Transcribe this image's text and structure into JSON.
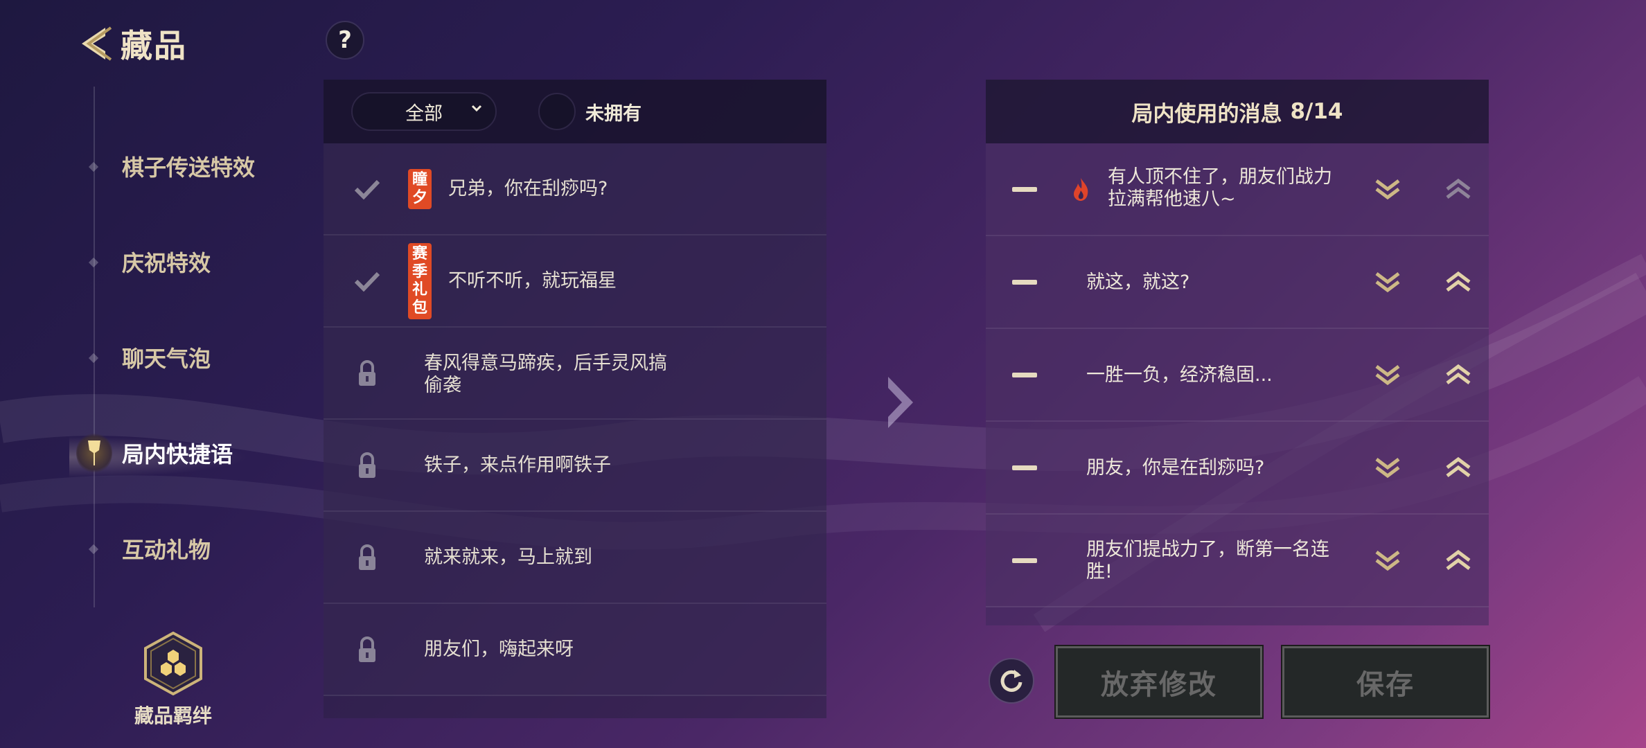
{
  "header": {
    "title": "藏品",
    "help_label": "?"
  },
  "sidebar": {
    "items": [
      {
        "label": "棋子传送特效",
        "active": false
      },
      {
        "label": "庆祝特效",
        "active": false
      },
      {
        "label": "聊天气泡",
        "active": false
      },
      {
        "label": "局内快捷语",
        "active": true
      },
      {
        "label": "互动礼物",
        "active": false
      }
    ],
    "bond_label": "藏品羁绊"
  },
  "filter": {
    "dropdown_value": "全部",
    "toggle_label": "未拥有"
  },
  "phrases": [
    {
      "text_lines": [
        "兄弟，你在刮痧吗?"
      ],
      "tag": "瞳夕",
      "status": "check-icon"
    },
    {
      "text_lines": [
        "不听不听，就玩福星"
      ],
      "tag": "赛季礼包",
      "status": "check-icon"
    },
    {
      "text_lines": [
        "春风得意马蹄疾，后手灵风搞",
        "偷袭"
      ],
      "tag": "",
      "status": "lock-icon"
    },
    {
      "text_lines": [
        "铁子，来点作用啊铁子"
      ],
      "tag": "",
      "status": "lock-icon"
    },
    {
      "text_lines": [
        "就来就来，马上就到"
      ],
      "tag": "",
      "status": "lock-icon"
    },
    {
      "text_lines": [
        "朋友们，嗨起来呀"
      ],
      "tag": "",
      "status": "lock-icon"
    }
  ],
  "in_game": {
    "title": "局内使用的消息",
    "count": "8/14",
    "items": [
      {
        "text_lines": [
          "有人顶不住了，朋友们战力",
          "拉满帮他速八~"
        ],
        "fire": true
      },
      {
        "text_lines": [
          "就这，就这?"
        ],
        "fire": false
      },
      {
        "text_lines": [
          "一胜一负，经济稳固..."
        ],
        "fire": false
      },
      {
        "text_lines": [
          "朋友，你是在刮痧吗?"
        ],
        "fire": false
      },
      {
        "text_lines": [
          "朋友们提战力了，断第一名连",
          "胜!"
        ],
        "fire": false
      }
    ]
  },
  "buttons": {
    "discard": "放弃修改",
    "save": "保存"
  },
  "colors": {
    "gold": "#d8c79a",
    "tag_red": "#e04a25",
    "button_bg": "#242828"
  }
}
